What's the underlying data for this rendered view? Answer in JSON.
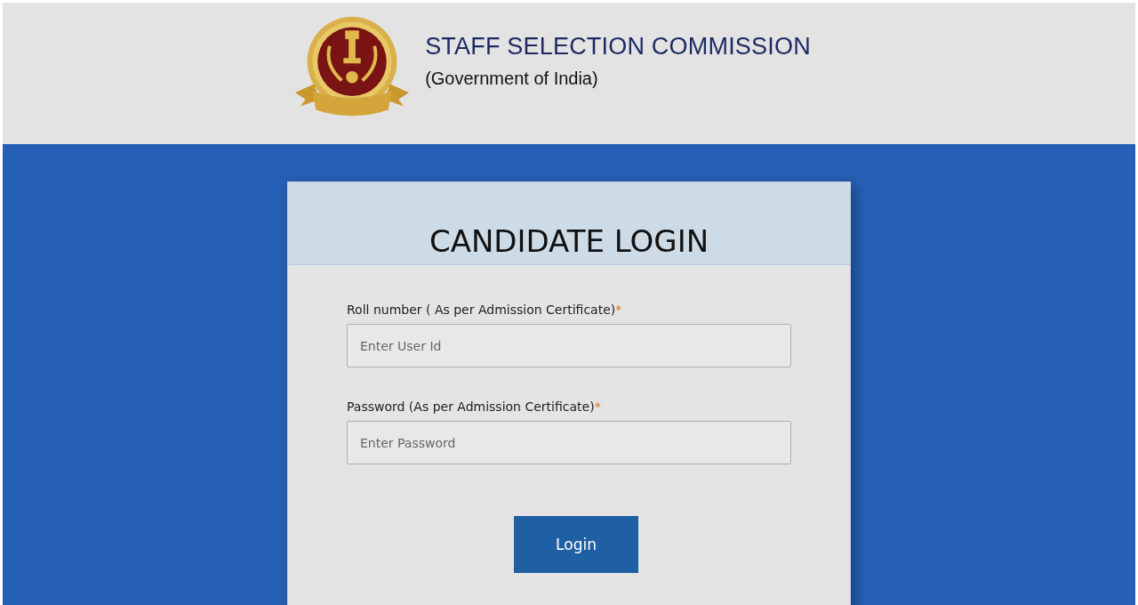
{
  "header": {
    "title": "STAFF SELECTION COMMISSION",
    "subtitle": "(Government of India)"
  },
  "login": {
    "title": "CANDIDATE LOGIN",
    "fields": [
      {
        "label": "Roll number ( As per Admission Certificate)",
        "required_mark": "*",
        "placeholder": "Enter User Id"
      },
      {
        "label": "Password (As per Admission Certificate)",
        "required_mark": "*",
        "placeholder": "Enter Password"
      }
    ],
    "button": "Login"
  }
}
